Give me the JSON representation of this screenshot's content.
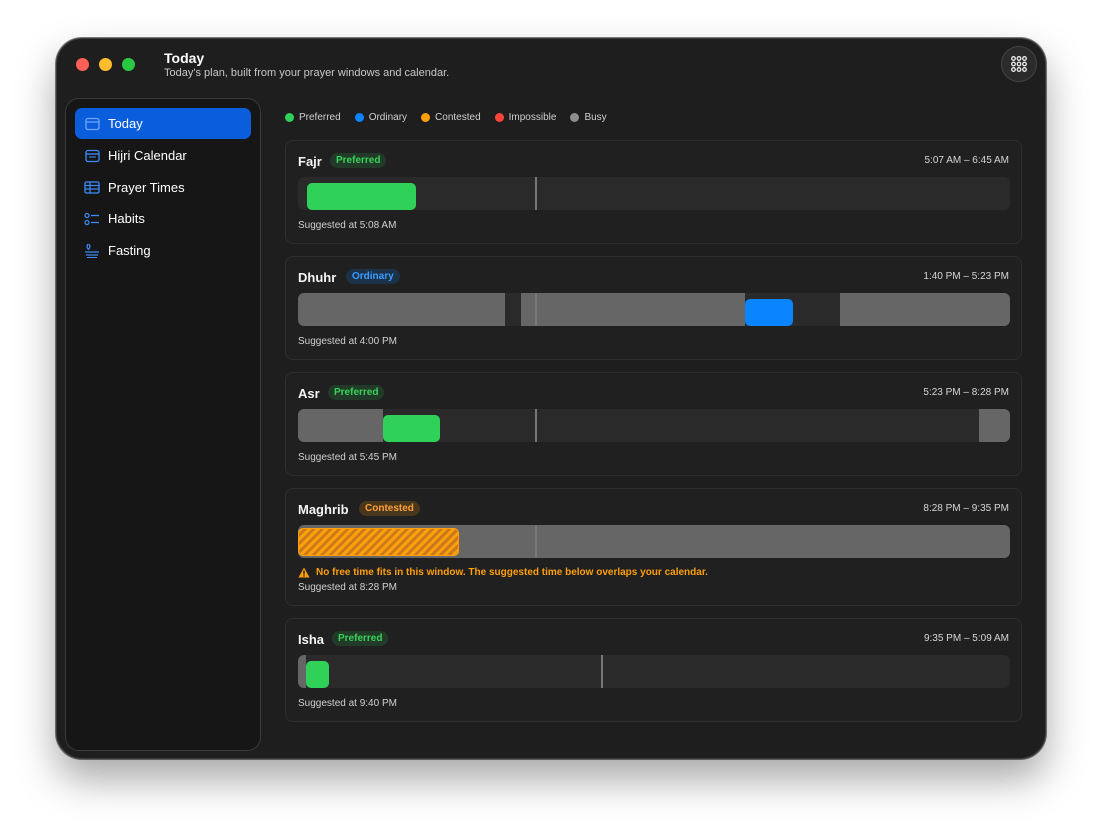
{
  "window": {
    "title": "Today",
    "subtitle": "Today's plan, built from your prayer windows and calendar."
  },
  "sidebar": {
    "items": [
      {
        "label": "Today",
        "icon": "calendar-today-icon",
        "active": true
      },
      {
        "label": "Hijri Calendar",
        "icon": "calendar-icon"
      },
      {
        "label": "Prayer Times",
        "icon": "table-icon"
      },
      {
        "label": "Habits",
        "icon": "checklist-icon"
      },
      {
        "label": "Fasting",
        "icon": "fasting-icon"
      }
    ]
  },
  "legend": [
    {
      "label": "Preferred",
      "color": "#30d158"
    },
    {
      "label": "Ordinary",
      "color": "#0a84ff"
    },
    {
      "label": "Contested",
      "color": "#ff9f0a"
    },
    {
      "label": "Impossible",
      "color": "#ff453a"
    },
    {
      "label": "Busy",
      "color": "#8e8e8e"
    }
  ],
  "prayers": [
    {
      "name": "Fajr",
      "badge": "Preferred",
      "range": "5:07 AM – 6:45 AM",
      "suggested": "Suggested at 5:08 AM"
    },
    {
      "name": "Dhuhr",
      "badge": "Ordinary",
      "range": "1:40 PM – 5:23 PM",
      "suggested": "Suggested at 4:00 PM"
    },
    {
      "name": "Asr",
      "badge": "Preferred",
      "range": "5:23 PM – 8:28 PM",
      "suggested": "Suggested at 5:45 PM"
    },
    {
      "name": "Maghrib",
      "badge": "Contested",
      "range": "8:28 PM – 9:35 PM",
      "warning": "No free time fits in this window. The suggested time below overlaps your calendar.",
      "suggested": "Suggested at 8:28 PM"
    },
    {
      "name": "Isha",
      "badge": "Preferred",
      "range": "9:35 PM – 5:09 AM",
      "suggested": "Suggested at 9:40 PM"
    }
  ],
  "colors": {
    "accent": "#0a5ddb",
    "preferred": "#30d158",
    "ordinary": "#0a84ff",
    "contested": "#ff9f0a",
    "busy": "#666666"
  }
}
